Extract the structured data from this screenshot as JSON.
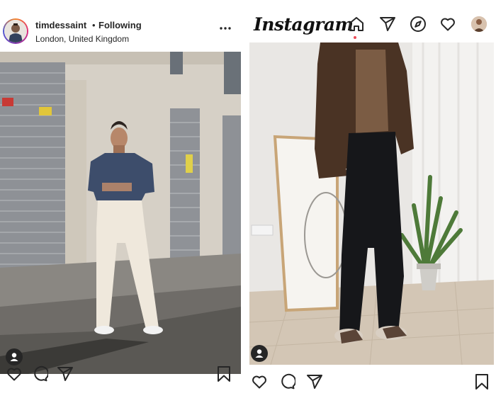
{
  "left_post": {
    "username": "timdessaint",
    "separator": "•",
    "follow_status": "Following",
    "location": "London, United Kingdom"
  },
  "right_post": {
    "app_name": "Instagram"
  },
  "icons": {
    "more": "more-options-icon",
    "like": "heart-icon",
    "comment": "comment-icon",
    "share": "paper-plane-icon",
    "save": "bookmark-icon",
    "home": "home-icon",
    "direct": "paper-plane-icon",
    "explore": "compass-icon",
    "activity": "heart-icon",
    "user_tag": "person-icon"
  },
  "colors": {
    "text": "#262626",
    "notification_dot": "#ed4956",
    "story_ring_start": "#f58529",
    "story_ring_end": "#8134af"
  }
}
